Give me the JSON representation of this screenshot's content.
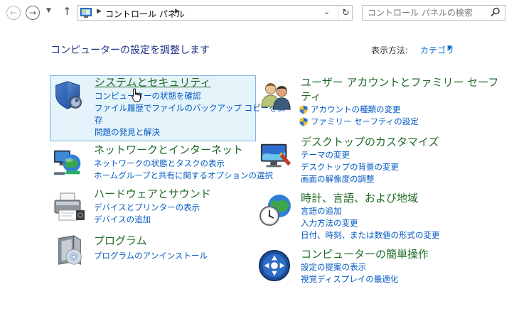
{
  "address_bar": {
    "breadcrumb": "コントロール パネル",
    "search_placeholder": "コントロール パネルの検索"
  },
  "header": {
    "title": "コンピューターの設定を調整します",
    "view_by_label": "表示方法:",
    "view_by_value": "カテゴリ"
  },
  "categories": [
    {
      "title": "システムとセキュリティ",
      "icon": "shield-icon",
      "links": [
        "コンピューターの状態を確認",
        "ファイル履歴でファイルのバックアップ コピーを保",
        "存",
        "問題の発見と解決"
      ]
    },
    {
      "title": "ネットワークとインターネット",
      "icon": "network-globe-icon",
      "links": [
        "ネットワークの状態とタスクの表示",
        "ホームグループと共有に関するオプションの選択"
      ]
    },
    {
      "title": "ハードウェアとサウンド",
      "icon": "printer-icon",
      "links": [
        "デバイスとプリンターの表示",
        "デバイスの追加"
      ]
    },
    {
      "title": "プログラム",
      "icon": "programs-box-icon",
      "links": [
        "プログラムのアンインストール"
      ]
    },
    {
      "title_line1": "ユーザー アカウントとファミリー セーフ",
      "title_line2": "ティ",
      "icon": "users-icon",
      "links": [
        "アカウントの種類の変更",
        "ファミリー セーフティの設定"
      ]
    },
    {
      "title": "デスクトップのカスタマイズ",
      "icon": "desktop-monitor-icon",
      "links": [
        "テーマの変更",
        "デスクトップの背景の変更",
        "画面の解像度の調整"
      ]
    },
    {
      "title": "時計、言語、および地域",
      "icon": "clock-globe-icon",
      "links": [
        "言語の追加",
        "入力方法の変更",
        "日付、時刻、または数値の形式の変更"
      ]
    },
    {
      "title": "コンピューターの簡単操作",
      "icon": "ease-of-access-icon",
      "links": [
        "設定の提案の表示",
        "視覚ディスプレイの最適化"
      ]
    }
  ]
}
